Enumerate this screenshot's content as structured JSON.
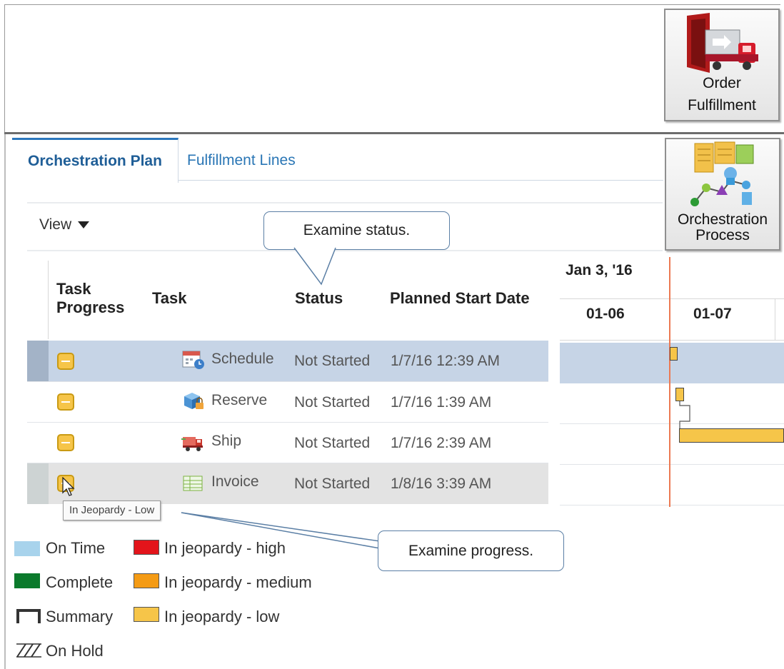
{
  "tiles": {
    "fulfillment": {
      "line1": "Order",
      "line2": "Fulfillment"
    },
    "orchestration": {
      "line1": "Orchestration",
      "line2": "Process"
    }
  },
  "tabs": [
    {
      "label": "Orchestration Plan",
      "active": true
    },
    {
      "label": "Fulfillment Lines",
      "active": false
    }
  ],
  "toolbar": {
    "view_label": "View"
  },
  "columns": {
    "task_progress_line1": "Task",
    "task_progress_line2": "Progress",
    "task": "Task",
    "status": "Status",
    "planned_start": "Planned Start Date"
  },
  "rows": [
    {
      "task": "Schedule",
      "icon": "calendar-clock-icon",
      "status": "Not Started",
      "planned_start": "1/7/16 12:39 AM",
      "progress": "In jeopardy - low",
      "selected": true
    },
    {
      "task": "Reserve",
      "icon": "reserve-box-lock-icon",
      "status": "Not Started",
      "planned_start": "1/7/16 1:39 AM",
      "progress": "In jeopardy - low"
    },
    {
      "task": "Ship",
      "icon": "truck-icon",
      "status": "Not Started",
      "planned_start": "1/7/16 2:39 AM",
      "progress": "In jeopardy - low"
    },
    {
      "task": "Invoice",
      "icon": "invoice-grid-icon",
      "status": "Not Started",
      "planned_start": "1/8/16 3:39 AM",
      "progress": "In jeopardy - low",
      "hovered": true
    }
  ],
  "gantt": {
    "week_label": "Jan 3, '16",
    "days": [
      "01-06",
      "01-07"
    ],
    "line_color": "#ec7a53",
    "bar_color": "#f6c549"
  },
  "tooltip": "In Jeopardy - Low",
  "callouts": {
    "status": "Examine status.",
    "progress": "Examine progress."
  },
  "legend": [
    {
      "label": "On Time",
      "color": "#a8d3ec",
      "icon": "swatch"
    },
    {
      "label": "In jeopardy - high",
      "color": "#e3141b",
      "icon": "swatch"
    },
    {
      "label": "Complete",
      "color": "#0b7a2c",
      "icon": "swatch"
    },
    {
      "label": "In jeopardy - medium",
      "color": "#f49b15",
      "icon": "swatch"
    },
    {
      "label": "Summary",
      "color": "#333333",
      "icon": "summary-bracket-icon"
    },
    {
      "label": "In jeopardy - low",
      "color": "#f6c549",
      "icon": "swatch"
    },
    {
      "label": "On Hold",
      "color": "#333333",
      "icon": "hatch-icon"
    }
  ]
}
